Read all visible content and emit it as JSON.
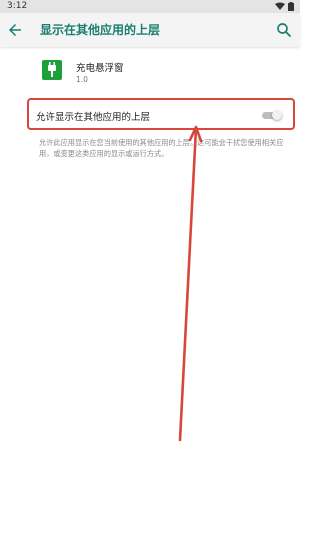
{
  "status_bar": {
    "time": "3:12"
  },
  "app_bar": {
    "title": "显示在其他应用的上层"
  },
  "app": {
    "name": "充电悬浮窗",
    "version": "1.0"
  },
  "permission": {
    "label": "允许显示在其他应用的上层",
    "enabled": false,
    "description": "允许此应用显示在您当前使用的其他应用的上层。这可能会干扰您使用相关应用，或变更这类应用的显示或运行方式。"
  },
  "colors": {
    "accent": "#1b7d6f",
    "annotation": "#d9463a",
    "app_icon": "#1ba03a"
  }
}
